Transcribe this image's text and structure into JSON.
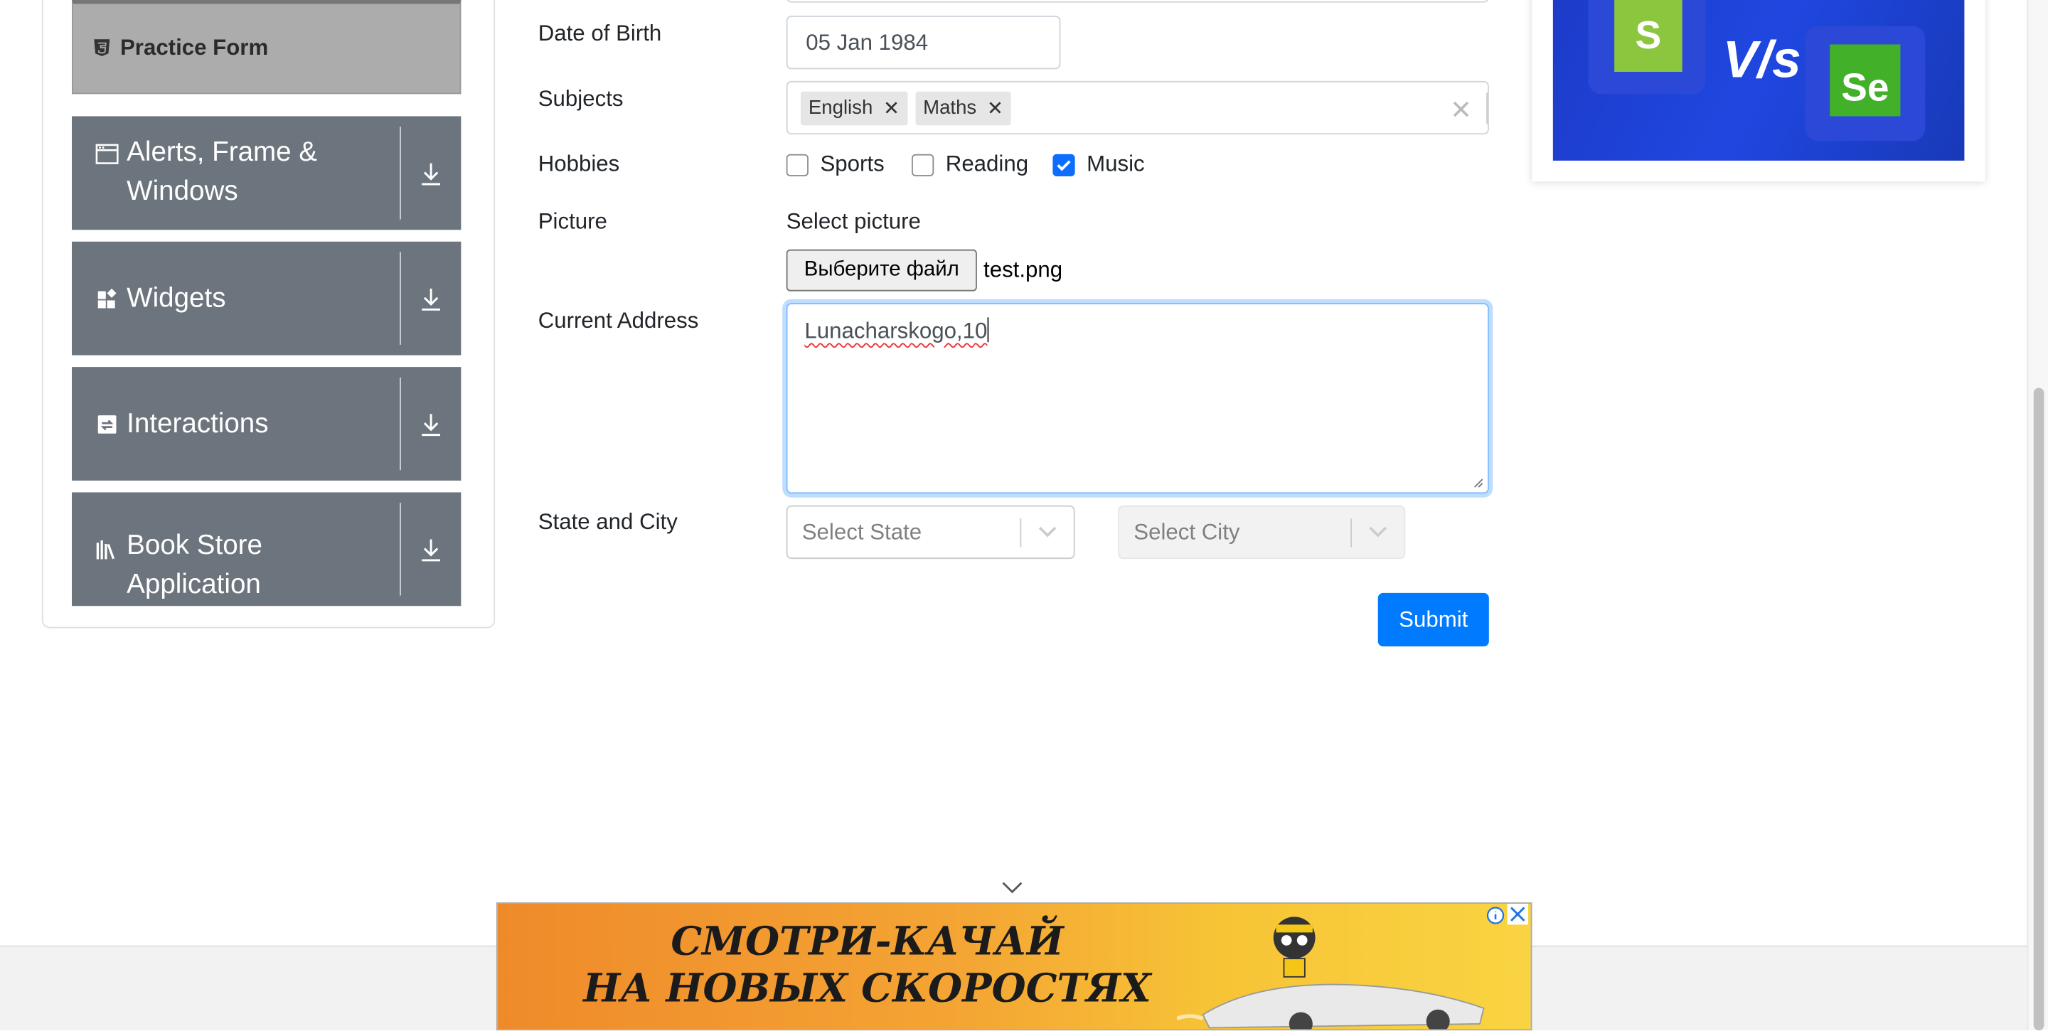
{
  "sidebar": {
    "practice_form": "Practice Form",
    "groups": [
      {
        "label_line1": "Alerts, Frame &",
        "label_line2": "Windows"
      },
      {
        "label_line1": "Widgets",
        "label_line2": ""
      },
      {
        "label_line1": "Interactions",
        "label_line2": ""
      },
      {
        "label_line1": "Book Store",
        "label_line2": "Application"
      }
    ]
  },
  "form": {
    "dob_label": "Date of Birth",
    "dob_value": "05 Jan 1984",
    "subjects_label": "Subjects",
    "subjects": [
      "English",
      "Maths"
    ],
    "hobbies_label": "Hobbies",
    "hobbies": [
      {
        "label": "Sports",
        "checked": false
      },
      {
        "label": "Reading",
        "checked": false
      },
      {
        "label": "Music",
        "checked": true
      }
    ],
    "picture_label": "Picture",
    "select_picture": "Select picture",
    "file_button": "Выберите файл",
    "file_name": "test.png",
    "address_label": "Current Address",
    "address_value": "Lunacharskogo,10",
    "state_city_label": "State and City",
    "state_placeholder": "Select State",
    "city_placeholder": "Select City",
    "submit": "Submit"
  },
  "ad_card": {
    "s_letter": "S",
    "vs": "V/s",
    "se_letters": "Se"
  },
  "banner": {
    "line1": "СМОТРИ-КАЧАЙ",
    "line2": "НА НОВЫХ СКОРОСТЯХ"
  },
  "colors": {
    "primary": "#007bff",
    "sidebar_group": "#6c757d",
    "active_item": "#acacac",
    "checkbox_checked": "#0d6efd"
  }
}
